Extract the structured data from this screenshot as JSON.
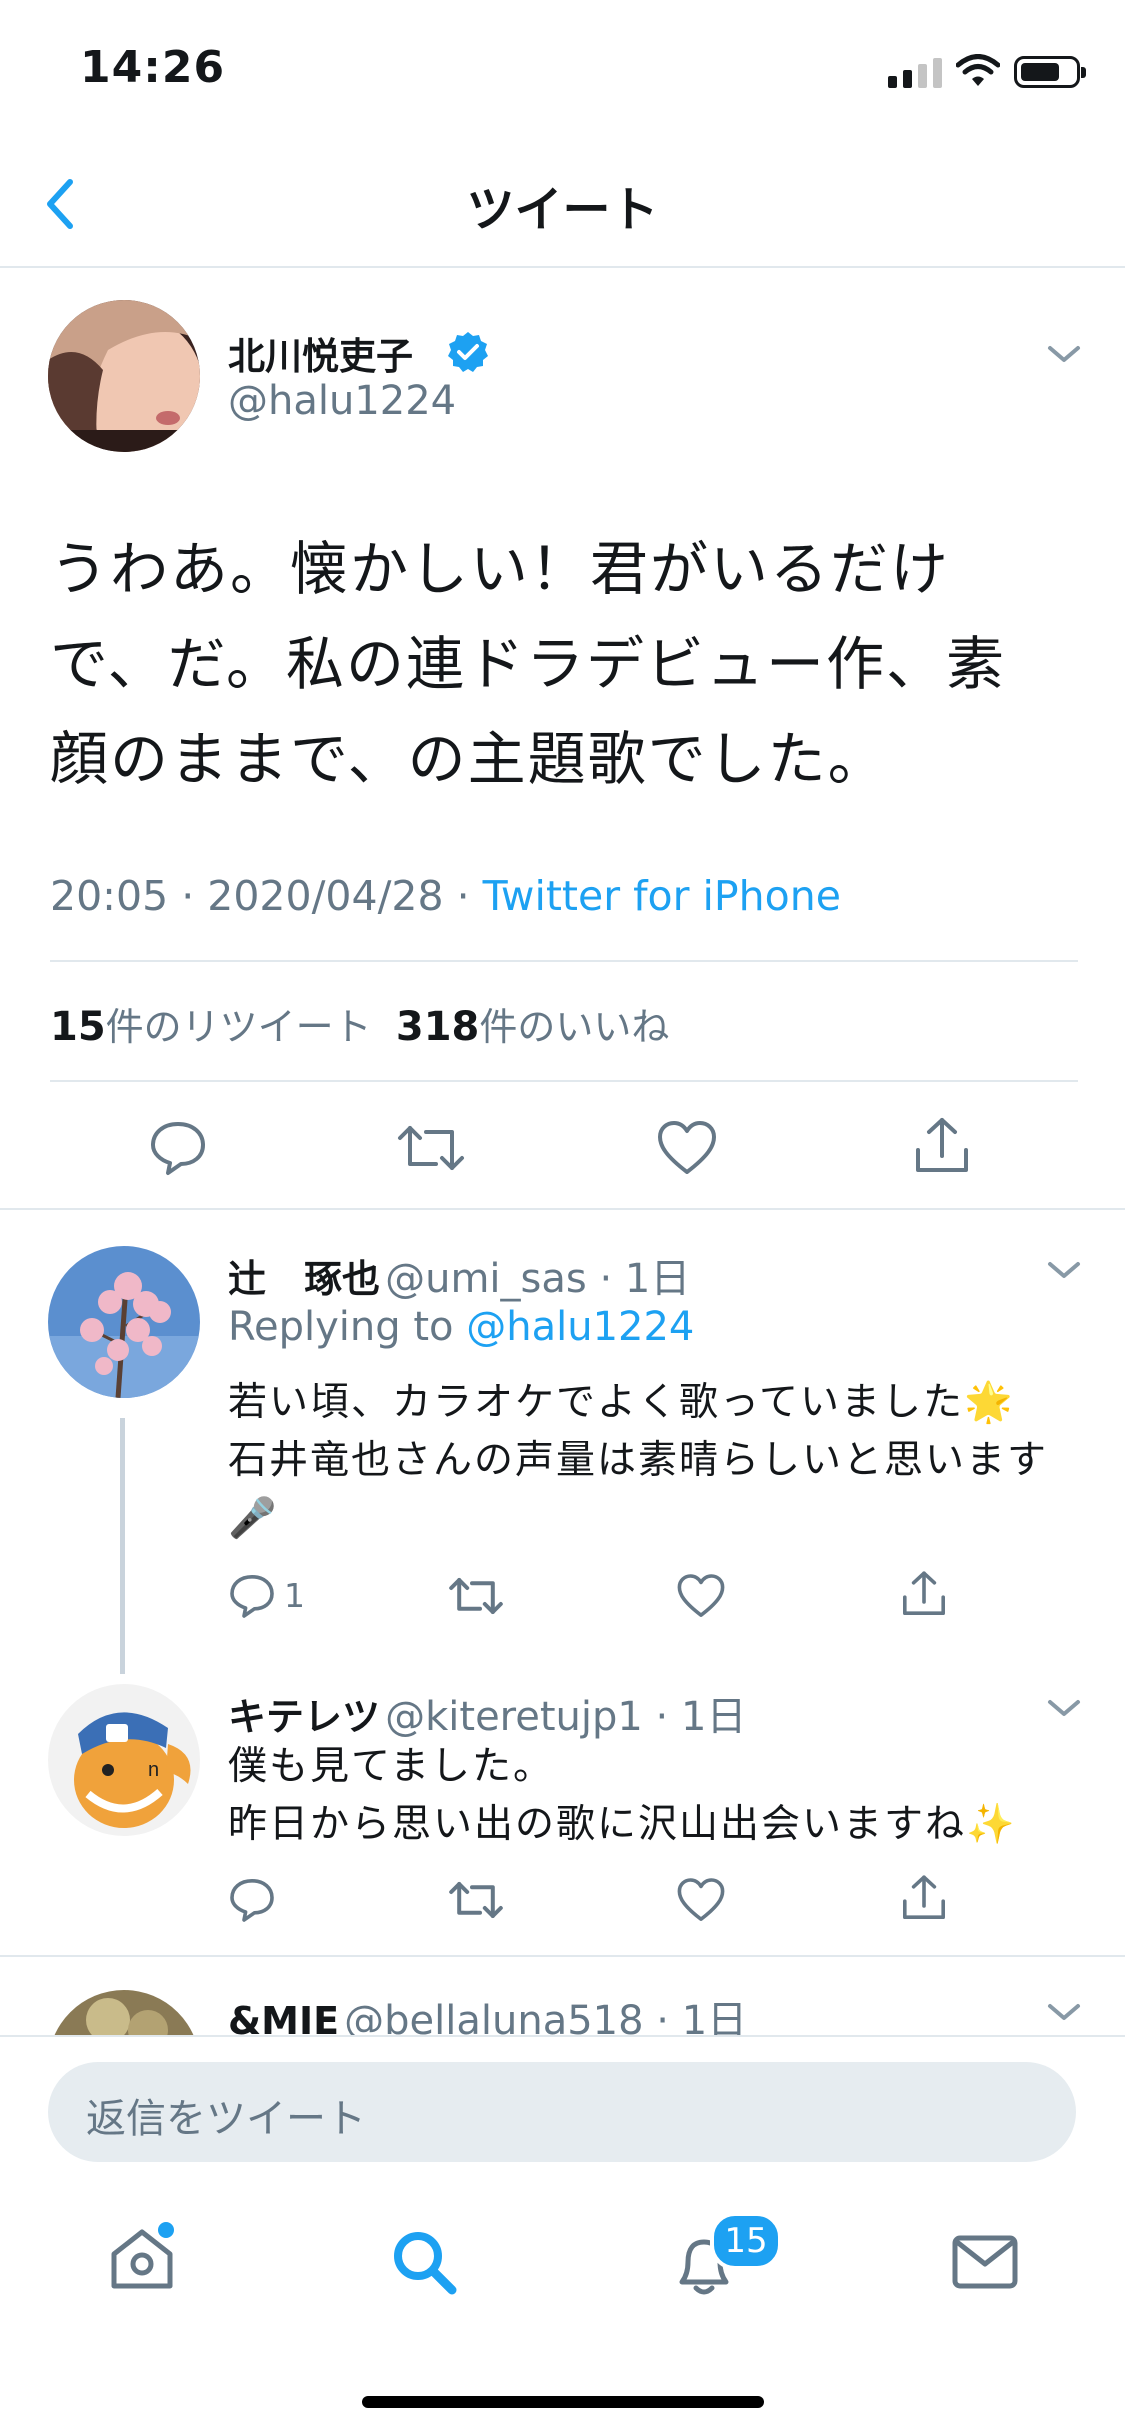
{
  "status_bar": {
    "time": "14:26"
  },
  "header": {
    "title": "ツイート"
  },
  "main_tweet": {
    "author_name": "北川悦吏子",
    "author_handle": "@halu1224",
    "body_lines": [
      "うわあ。懐かしい！君がいるだけ",
      "で、だ。私の連ドラデビュー作、素",
      "顔のままで、の主題歌でした。"
    ],
    "timestamp": "20:05 · 2020/04/28 · ",
    "source": "Twitter for iPhone",
    "retweet_count": "15",
    "retweet_label": "件のリツイート",
    "like_count": "318",
    "like_label": "件のいいね"
  },
  "replies": [
    {
      "author_name": "辻　琢也",
      "author_handle": "@umi_sas · 1日",
      "replying_prefix": "Replying to ",
      "replying_to": "@halu1224",
      "text_lines": [
        "若い頃、カラオケでよく歌っていました🌟",
        "石井竜也さんの声量は素晴らしいと思います",
        "🎤"
      ],
      "reply_count": "1"
    },
    {
      "author_name": "キテレツ",
      "author_handle": "@kiteretujp1 · 1日",
      "text_lines": [
        "僕も見てました。",
        "昨日から思い出の歌に沢山出会いますね✨"
      ]
    },
    {
      "author_name": "&MIE",
      "author_handle": "@bellaluna518 · 1日"
    }
  ],
  "compose": {
    "placeholder": "返信をツイート"
  },
  "tab_bar": {
    "notifications_badge": "15"
  },
  "colors": {
    "accent": "#1da1f2",
    "secondary_text": "#657786",
    "divider": "#e1e8ed"
  }
}
